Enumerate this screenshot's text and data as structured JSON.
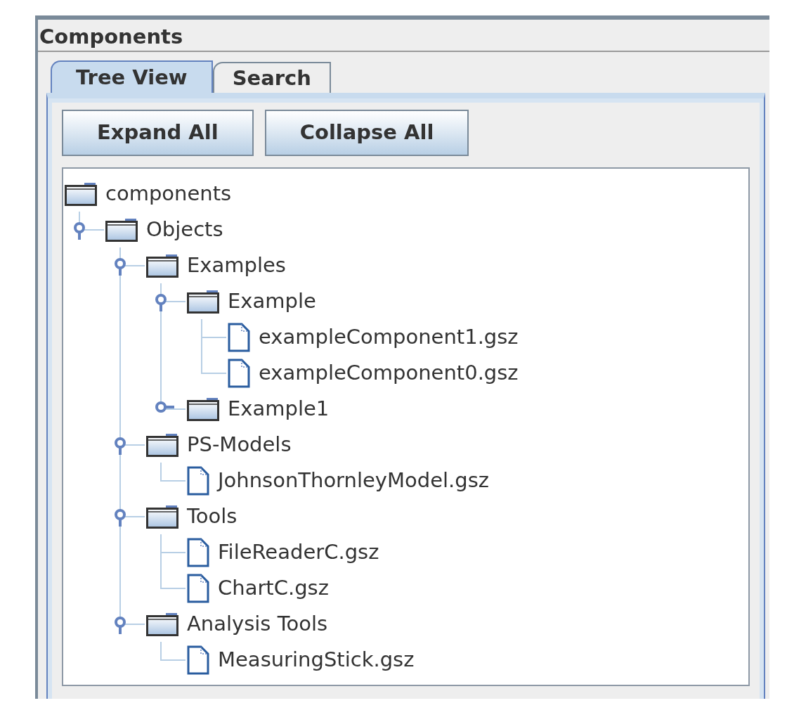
{
  "panel": {
    "title": "Components"
  },
  "tabs": [
    {
      "label": "Tree View",
      "selected": true
    },
    {
      "label": "Search",
      "selected": false
    }
  ],
  "buttons": [
    "Expand All",
    "Collapse All"
  ],
  "tree": {
    "root": {
      "kind": "folder",
      "label": "components",
      "children": [
        {
          "kind": "folder",
          "label": "Objects",
          "expanded": true,
          "children": [
            {
              "kind": "folder",
              "label": "Examples",
              "expanded": true,
              "children": [
                {
                  "kind": "folder",
                  "label": "Example",
                  "expanded": true,
                  "children": [
                    {
                      "kind": "file",
                      "label": "exampleComponent1.gsz"
                    },
                    {
                      "kind": "file",
                      "label": "exampleComponent0.gsz"
                    }
                  ]
                },
                {
                  "kind": "folder",
                  "label": "Example1",
                  "expanded": false
                }
              ]
            },
            {
              "kind": "folder",
              "label": "PS-Models",
              "expanded": true,
              "children": [
                {
                  "kind": "file",
                  "label": "JohnsonThornleyModel.gsz"
                }
              ]
            },
            {
              "kind": "folder",
              "label": "Tools",
              "expanded": true,
              "children": [
                {
                  "kind": "file",
                  "label": "FileReaderC.gsz"
                },
                {
                  "kind": "file",
                  "label": "ChartC.gsz"
                }
              ]
            },
            {
              "kind": "folder",
              "label": "Analysis Tools",
              "expanded": true,
              "children": [
                {
                  "kind": "file",
                  "label": "MeasuringStick.gsz"
                }
              ]
            }
          ]
        }
      ]
    }
  }
}
